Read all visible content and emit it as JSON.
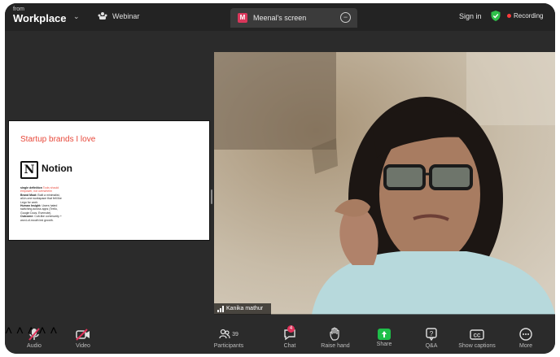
{
  "header": {
    "brand_sup": "from",
    "brand_name": "Workplace",
    "webinar_label": "Webinar",
    "share_tab_avatar": "M",
    "share_tab_label": "Meenal's screen",
    "sign_in": "Sign in",
    "recording_label": "Recording"
  },
  "slide": {
    "title": "Startup brands I love",
    "logo_letter": "N",
    "brand_name": "Notion",
    "body": [
      {
        "bold": "single definition",
        "red": " Tools should",
        "text": ""
      },
      {
        "bold": "",
        "red": "empower, not overwhelm",
        "text": ""
      },
      {
        "bold": "Brand Moat:",
        "red": "",
        "text": " Built a minimalist,"
      },
      {
        "bold": "",
        "red": "",
        "text": "all-in-one workspace that felt like"
      },
      {
        "bold": "",
        "red": "",
        "text": "Lego for work"
      },
      {
        "bold": "Human Insight:",
        "red": "",
        "text": " Users hated"
      },
      {
        "bold": "",
        "red": "",
        "text": "switching across apps (Trello,"
      },
      {
        "bold": "",
        "red": "",
        "text": "Google Docs, Evernote)."
      },
      {
        "bold": "Outcome:",
        "red": "",
        "text": " Cult-like community +"
      },
      {
        "bold": "",
        "red": "",
        "text": "word-of-mouth led growth."
      }
    ]
  },
  "video": {
    "participant_name": "Kanika mathur"
  },
  "toolbar": {
    "audio": "Audio",
    "video": "Video",
    "participants": "Participants",
    "participants_count": "39",
    "chat": "Chat",
    "chat_badge": "4",
    "raise_hand": "Raise hand",
    "share": "Share",
    "qa": "Q&A",
    "captions": "Show captions",
    "more": "More"
  },
  "colors": {
    "background": "#2b2b2b",
    "topbar": "#232323",
    "accent_red": "#e8483a",
    "share_green": "#1fbf4a",
    "record_red": "#ff3b3b"
  }
}
